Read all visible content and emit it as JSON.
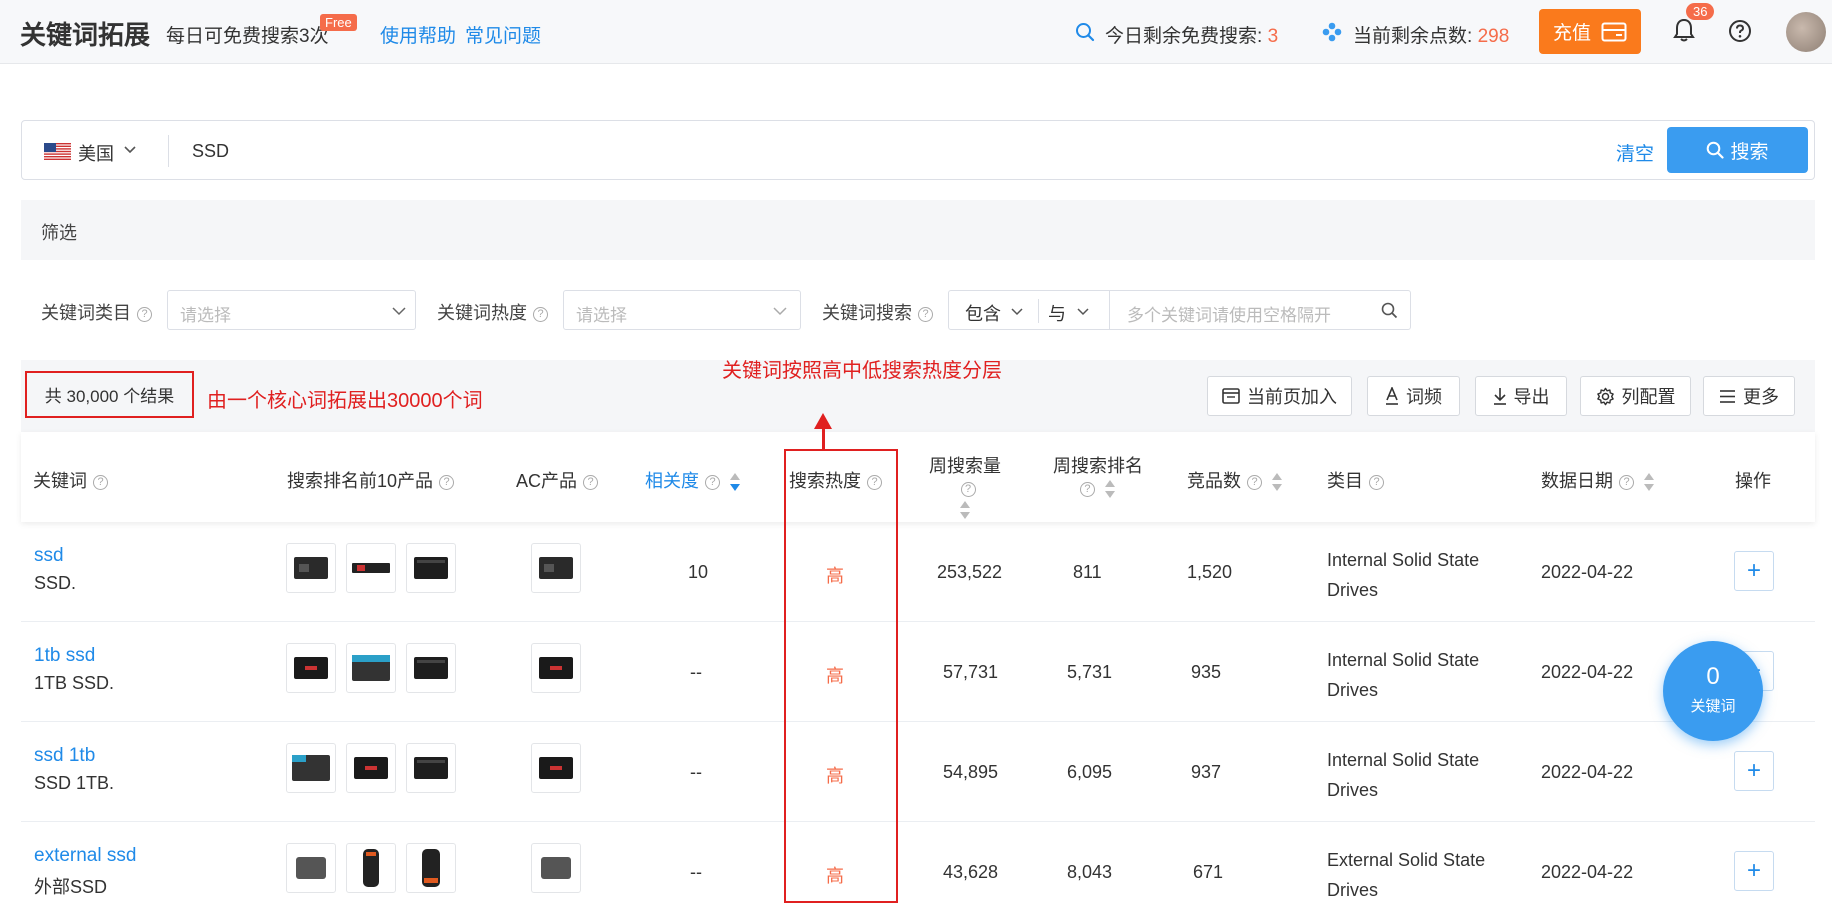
{
  "header": {
    "title": "关键词拓展",
    "free_tip": "每日可免费搜索3次",
    "free_badge": "Free",
    "links": [
      "使用帮助",
      "常见问题"
    ],
    "free_search_label": "今日剩余免费搜索:",
    "free_search_count": "3",
    "points_label": "当前剩余点数:",
    "points_count": "298",
    "recharge_label": "充值",
    "notification_count": "36"
  },
  "search": {
    "country": "美国",
    "query": "SSD",
    "clear_label": "清空",
    "search_label": "搜索"
  },
  "filter": {
    "title": "筛选",
    "category_label": "关键词类目",
    "category_placeholder": "请选择",
    "heat_label": "关键词热度",
    "heat_placeholder": "请选择",
    "search_label": "关键词搜索",
    "match_mode": "包含",
    "logic_mode": "与",
    "keyword_placeholder": "多个关键词请使用空格隔开"
  },
  "results": {
    "count_text": "共 30,000 个结果",
    "annotation_count": "由一个核心词拓展出30000个词",
    "annotation_heat": "关键词按照高中低搜索热度分层",
    "tools": [
      "当前页加入",
      "词频",
      "导出",
      "列配置",
      "更多"
    ]
  },
  "table": {
    "headers": {
      "keyword": "关键词",
      "top10": "搜索排名前10产品",
      "ac": "AC产品",
      "relevance": "相关度",
      "heat": "搜索热度",
      "weekly_volume": "周搜索量",
      "weekly_rank": "周搜索排名",
      "competitors": "竞品数",
      "category": "类目",
      "date": "数据日期",
      "action": "操作"
    },
    "rows": [
      {
        "keyword": "ssd",
        "translation": "SSD.",
        "relevance": "10",
        "heat": "高",
        "volume": "253,522",
        "rank": "811",
        "competitors": "1,520",
        "category": "Internal Solid State Drives",
        "date": "2022-04-22"
      },
      {
        "keyword": "1tb ssd",
        "translation": "1TB SSD.",
        "relevance": "--",
        "heat": "高",
        "volume": "57,731",
        "rank": "5,731",
        "competitors": "935",
        "category": "Internal Solid State Drives",
        "date": "2022-04-22"
      },
      {
        "keyword": "ssd 1tb",
        "translation": "SSD 1TB.",
        "relevance": "--",
        "heat": "高",
        "volume": "54,895",
        "rank": "6,095",
        "competitors": "937",
        "category": "Internal Solid State Drives",
        "date": "2022-04-22"
      },
      {
        "keyword": "external ssd",
        "translation": "外部SSD",
        "relevance": "--",
        "heat": "高",
        "volume": "43,628",
        "rank": "8,043",
        "competitors": "671",
        "category": "External Solid State Drives",
        "date": "2022-04-22"
      }
    ]
  },
  "floating": {
    "count": "0",
    "label": "关键词"
  },
  "colors": {
    "primary": "#3a9cf0",
    "link": "#1f8ae8",
    "accent_orange": "#fa7a1c",
    "heat_high": "#f56c4a",
    "annotation_red": "#e02020"
  }
}
